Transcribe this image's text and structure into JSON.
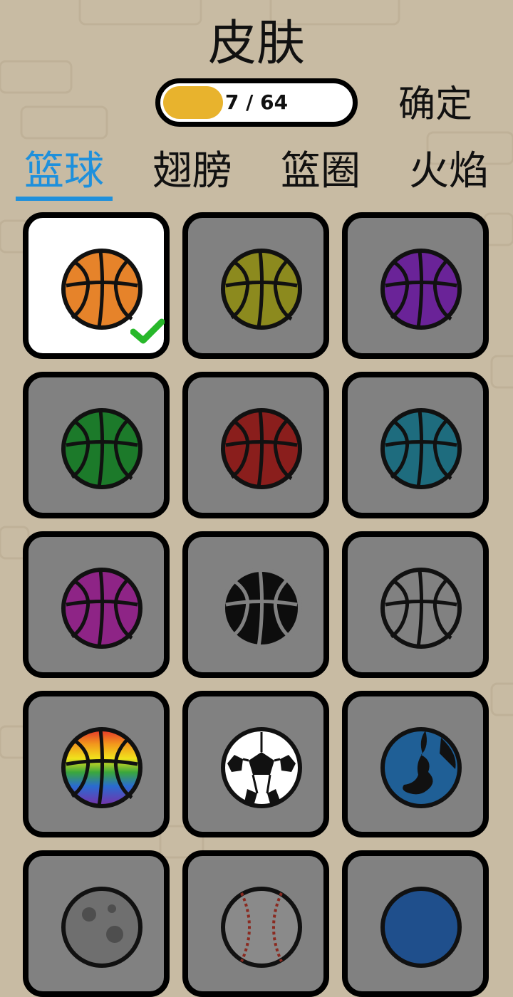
{
  "header": {
    "title": "皮肤",
    "confirm_label": "确定"
  },
  "progress": {
    "text": "7 / 64",
    "unlocked": 7,
    "total": 64,
    "fill_fraction": 0.31,
    "fill_color": "#e8b32d"
  },
  "tabs": [
    {
      "label": "篮球",
      "active": true
    },
    {
      "label": "翅膀",
      "active": false
    },
    {
      "label": "篮圈",
      "active": false
    },
    {
      "label": "火焰",
      "active": false
    }
  ],
  "accent_color": "#1e90dc",
  "skins": [
    {
      "name": "orange-basketball",
      "kind": "basketball",
      "color": "#e6832a",
      "line": "#111111",
      "selected": true
    },
    {
      "name": "olive-basketball",
      "kind": "basketball",
      "color": "#8c8a1e",
      "line": "#111111",
      "selected": false
    },
    {
      "name": "purple-basketball",
      "kind": "basketball",
      "color": "#6a2398",
      "line": "#111111",
      "selected": false
    },
    {
      "name": "green-basketball",
      "kind": "basketball",
      "color": "#1c7a2a",
      "line": "#111111",
      "selected": false
    },
    {
      "name": "red-basketball",
      "kind": "basketball",
      "color": "#8a1e1c",
      "line": "#111111",
      "selected": false
    },
    {
      "name": "teal-basketball",
      "kind": "basketball",
      "color": "#1e6c7e",
      "line": "#111111",
      "selected": false
    },
    {
      "name": "magenta-basketball",
      "kind": "basketball",
      "color": "#8e2486",
      "line": "#111111",
      "selected": false
    },
    {
      "name": "black-basketball",
      "kind": "basketball",
      "color": "#0d0d0d",
      "line": "#818181",
      "selected": false
    },
    {
      "name": "outline-basketball",
      "kind": "basketball",
      "color": "#818181",
      "line": "#111111",
      "selected": false
    },
    {
      "name": "rainbow-basketball",
      "kind": "rainbow",
      "color": "#e6832a",
      "line": "#111111",
      "selected": false
    },
    {
      "name": "soccer-ball",
      "kind": "soccer",
      "color": "#ffffff",
      "line": "#111111",
      "selected": false
    },
    {
      "name": "earth-ball",
      "kind": "earth",
      "color": "#1f5f96",
      "line": "#111111",
      "selected": false
    },
    {
      "name": "moon-ball",
      "kind": "moon",
      "color": "#6f6f6f",
      "line": "#111111",
      "selected": false
    },
    {
      "name": "baseball-ball",
      "kind": "baseball",
      "color": "#8a8a8a",
      "line": "#111111",
      "selected": false
    },
    {
      "name": "blue-ball",
      "kind": "plain",
      "color": "#1f4f8c",
      "line": "#111111",
      "selected": false
    }
  ]
}
